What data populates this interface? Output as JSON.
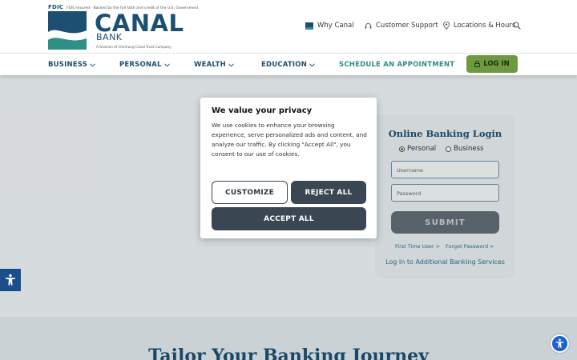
{
  "header": {
    "fdic_badge": "FDIC",
    "fdic_notice": "FDIC-Insured - Backed by the full faith and credit of the U.S. Government",
    "logo_word": "CANAL",
    "logo_bank": "BANK",
    "logo_sub": "A Division of Chemung Canal Trust Company",
    "util_links": [
      {
        "label": "Why Canal",
        "icon": "flag-icon"
      },
      {
        "label": "Customer Support",
        "icon": "headset-icon"
      },
      {
        "label": "Locations & Hours",
        "icon": "map-pin-icon"
      }
    ],
    "search_icon": "search-icon"
  },
  "nav": {
    "items": [
      {
        "label": "BUSINESS"
      },
      {
        "label": "PERSONAL"
      },
      {
        "label": "WEALTH"
      },
      {
        "label": "EDUCATION"
      }
    ],
    "schedule": "SCHEDULE AN APPOINTMENT",
    "login": "LOG IN"
  },
  "login_card": {
    "title": "Online Banking Login",
    "radio_personal": "Personal",
    "radio_business": "Business",
    "selected": "Personal",
    "username_placeholder": "Username",
    "password_placeholder": "Password",
    "submit": "SUBMIT",
    "first_time": "First Time User >",
    "forgot": "Forgot Password >",
    "additional": "Log In to Additional Banking Services"
  },
  "hero": {
    "heading": "Tailor Your Banking Journey"
  },
  "cookie_modal": {
    "title": "We value your privacy",
    "body": "We use cookies to enhance your browsing experience, serve personalized ads and content, and analyze our traffic. By clicking \"Accept All\", you consent to our use of cookies.",
    "customize": "CUSTOMIZE",
    "reject": "REJECT ALL",
    "accept": "ACCEPT ALL"
  },
  "colors": {
    "brand_navy": "#1c4f71",
    "brand_teal": "#2f8f84",
    "login_green": "#6e9a3f",
    "modal_button": "#3a4651"
  }
}
